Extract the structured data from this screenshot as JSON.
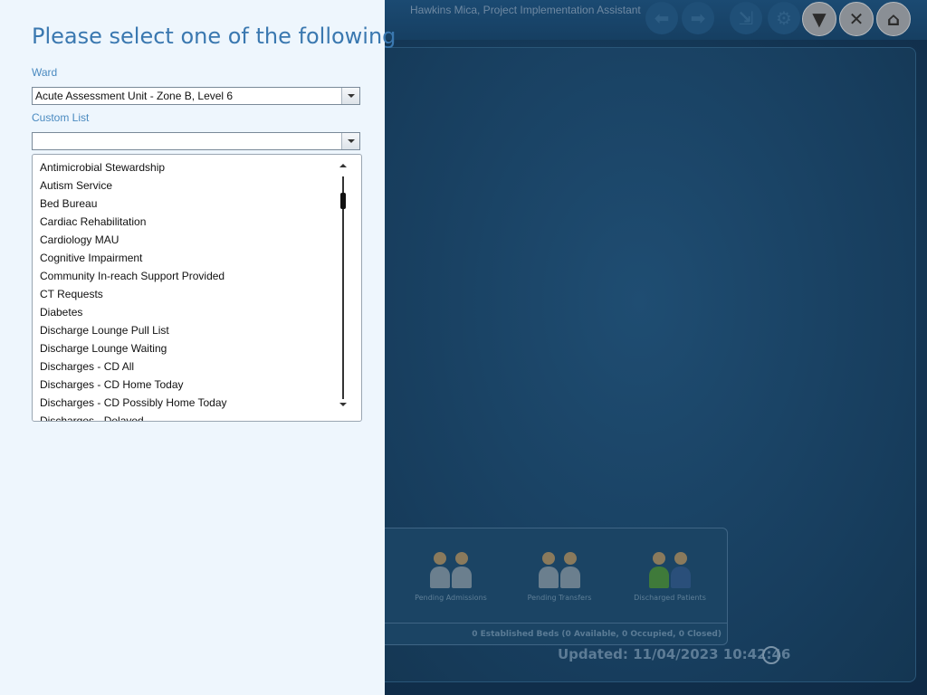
{
  "background": {
    "user_title": "Hawkins Mica, Project Implementation Assistant",
    "header_buttons": [
      {
        "name": "back-icon",
        "glyph": "⬅"
      },
      {
        "name": "forward-icon",
        "glyph": "➡"
      },
      {
        "name": "export-icon",
        "glyph": "⇲"
      },
      {
        "name": "settings-icon",
        "glyph": "⚙"
      },
      {
        "name": "filter-icon",
        "glyph": "▼"
      },
      {
        "name": "close-icon",
        "glyph": "✕"
      },
      {
        "name": "home-icon",
        "glyph": "⌂"
      }
    ],
    "tiles": [
      {
        "label": "Pending Admissions"
      },
      {
        "label": "Pending Transfers"
      },
      {
        "label": "Discharged Patients"
      }
    ],
    "beds_summary": "0 Established Beds (0 Available, 0 Occupied, 0 Closed)",
    "updated": "Updated: 11/04/2023 10:42:46"
  },
  "dialog": {
    "title": "Please select one of the following",
    "ward_label": "Ward",
    "ward_value": "Acute Assessment Unit - Zone B, Level 6",
    "custom_list_label": "Custom List",
    "custom_list_value": "",
    "options": [
      "Antimicrobial Stewardship",
      "Autism Service",
      "Bed Bureau",
      "Cardiac Rehabilitation",
      "Cardiology MAU",
      "Cognitive Impairment",
      "Community In-reach Support Provided",
      "CT Requests",
      "Diabetes",
      "Discharge Lounge Pull List",
      "Discharge Lounge Waiting",
      "Discharges - CD All",
      "Discharges - CD Home Today",
      "Discharges - CD Possibly Home Today",
      "Discharges - Delayed"
    ]
  },
  "colors": {
    "dialog_bg": "#eef6fd",
    "title": "#3a78b0",
    "label": "#4a8ac0"
  }
}
